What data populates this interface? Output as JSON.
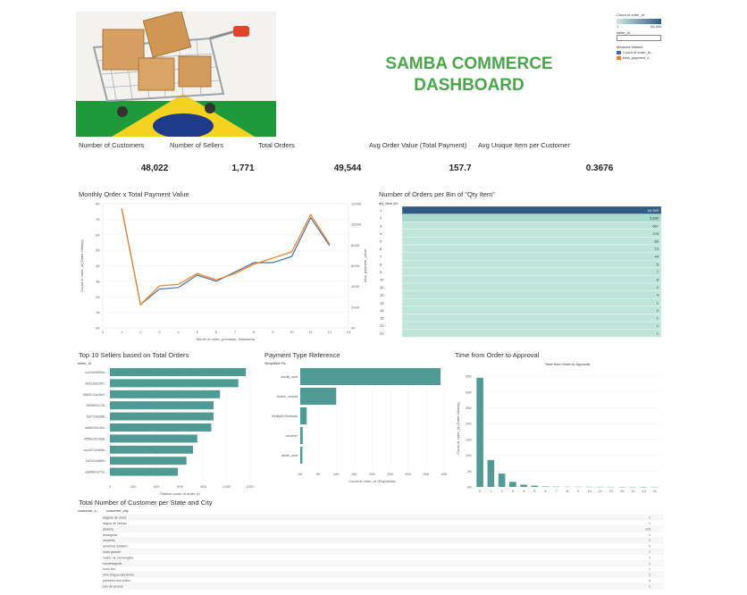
{
  "dashboard": {
    "title_line1": "SAMBA COMMERCE",
    "title_line2": "DASHBOARD"
  },
  "legend": {
    "count_title": "Count of order_id",
    "range_min": "1",
    "range_max": "44,484",
    "seller_filter_label": "seller_id",
    "measure_names_title": "Measure Names",
    "measure1": "Count of order_id...",
    "measure2": "total_payment_v...",
    "color_count": "#4a6fa5",
    "color_payment": "#f07f1b"
  },
  "kpis": [
    {
      "label": "Number of Customers",
      "value": "48,022"
    },
    {
      "label": "Number of Sellers",
      "value": "1,771"
    },
    {
      "label": "Total Orders",
      "value": "49,544"
    },
    {
      "label": "Avg Order Value (Total Payment)",
      "value": "157.7"
    },
    {
      "label": "Avg Unique Item per Customer",
      "value": "0.3676"
    }
  ],
  "sections": {
    "monthly": "Monthly Order x Total Payment Value",
    "bins": "Number of Orders per Bin of \"Qty Item\"",
    "sellers": "Top 10 Sellers based on Total Orders",
    "payment": "Payment Type Reference",
    "approval": "Time from Order to Approval",
    "state_city": "Total Number of Customer per State and City"
  },
  "chart_data": [
    {
      "type": "line",
      "title": "Monthly Order x Total Payment Value",
      "xlabel": "Month of order_purchase_timestamp",
      "ylabel": "Count of order_id (Order History)",
      "ylabel2": "total_payment_value",
      "x": [
        1,
        2,
        3,
        4,
        5,
        6,
        7,
        8,
        9,
        10,
        11,
        12
      ],
      "x_ticks": [
        0,
        1,
        2,
        3,
        4,
        5,
        6,
        7,
        8,
        9,
        10,
        11,
        12,
        13
      ],
      "y_ticks": [
        "0K",
        "1K",
        "2K",
        "3K",
        "4K",
        "5K",
        "6K",
        "7K",
        "8K"
      ],
      "y2_ticks": [
        "0K",
        "200K",
        "400K",
        "600K",
        "800K",
        "1000K",
        "1200K"
      ],
      "ylim": [
        0,
        8000
      ],
      "y2lim": [
        0,
        1200000
      ],
      "series": [
        {
          "color": "#4a6fa5",
          "values": [
            7700,
            1500,
            2500,
            2600,
            3400,
            3000,
            3600,
            4200,
            4200,
            4600,
            7100,
            5300
          ]
        },
        {
          "color": "#f07f1b",
          "values": [
            7700,
            1500,
            2700,
            2800,
            3500,
            3100,
            3500,
            4100,
            4500,
            4900,
            7300,
            5400
          ]
        }
      ]
    },
    {
      "type": "table",
      "title": "Number of Orders per Bin of \"Qty Item\"",
      "header": "qty_item (bi..",
      "rows": [
        {
          "bin": "1",
          "value": "44,393"
        },
        {
          "bin": "2",
          "value": "3,830"
        },
        {
          "bin": "3",
          "value": "667"
        },
        {
          "bin": "4",
          "value": "279"
        },
        {
          "bin": "5",
          "value": "83"
        },
        {
          "bin": "6",
          "value": "73"
        },
        {
          "bin": "7",
          "value": "44"
        },
        {
          "bin": "8",
          "value": "5"
        },
        {
          "bin": "9",
          "value": "7"
        },
        {
          "bin": "10",
          "value": "8"
        },
        {
          "bin": "11",
          "value": "2"
        },
        {
          "bin": "12",
          "value": "4"
        },
        {
          "bin": "13",
          "value": "1"
        },
        {
          "bin": "14",
          "value": "2"
        },
        {
          "bin": "15",
          "value": "1"
        },
        {
          "bin": "20",
          "value": "1"
        },
        {
          "bin": "21",
          "value": "1"
        }
      ]
    },
    {
      "type": "bar",
      "title": "Top 10 Sellers based on Total Orders",
      "header": "seller_id",
      "xlabel": "Distinct count of order_id",
      "categories": [
        "cc419e0650a...",
        "4a3ca9315b7...",
        "6560211a19b4...",
        "1f50f920176f...",
        "7a67c3be8f8...",
        "da8622b14eb...",
        "955fee9216a6...",
        "cca3071e3e9b...",
        "7c67e1448b0...",
        "ea8482cd71d..."
      ],
      "values": [
        1260,
        1190,
        1020,
        960,
        960,
        940,
        810,
        770,
        710,
        630
      ],
      "x_ticks": [
        "0",
        "200",
        "400",
        "600",
        "800",
        "1000",
        "1200"
      ],
      "xlim": [
        0,
        1300
      ],
      "color": "#4f9a94"
    },
    {
      "type": "bar",
      "title": "Payment Type Reference",
      "header": "Simplified Pa..",
      "xlabel": "Count of order_id (Payments)",
      "categories": [
        "credit_card",
        "boleto_cricket",
        "Multiple Methods",
        "voucher",
        "debit_card"
      ],
      "values": [
        39000,
        10000,
        1800,
        700,
        600
      ],
      "x_ticks": [
        "0K",
        "5K",
        "10K",
        "15K",
        "20K",
        "25K",
        "30K",
        "35K",
        "40K"
      ],
      "xlim": [
        0,
        40000
      ],
      "color": "#4f9a94"
    },
    {
      "type": "bar",
      "title": "Time from Order to Approval",
      "ylabel": "Count of order_id (Order History)",
      "categories": [
        "0",
        "1",
        "2",
        "3",
        "4",
        "5",
        "6",
        "7",
        "8",
        "9",
        "10",
        "11",
        "12",
        "13",
        "14",
        "15",
        "31"
      ],
      "values": [
        34500,
        8500,
        4200,
        1600,
        700,
        400,
        150,
        100,
        60,
        40,
        30,
        20,
        15,
        10,
        8,
        5,
        3
      ],
      "y_ticks": [
        "0K",
        "5K",
        "10K",
        "15K",
        "20K",
        "25K",
        "30K",
        "35K"
      ],
      "ylim": [
        0,
        37000
      ],
      "color": "#4f9a94"
    },
    {
      "type": "table",
      "title": "Total Number of Customer per State and City",
      "headers": [
        "customer_s..",
        "customer_city"
      ],
      "rows": [
        {
          "city": "aaguas de arara",
          "value": "1"
        },
        {
          "city": "aagua de campo",
          "value": "1"
        },
        {
          "city": "abaeiro",
          "value": "123"
        },
        {
          "city": "amargosa",
          "value": "1"
        },
        {
          "city": "amarello",
          "value": "1"
        },
        {
          "city": "amarinal daidieiro",
          "value": "2"
        },
        {
          "city": "mata grande",
          "value": "2"
        },
        {
          "city": "matriz de camaragibe",
          "value": "1"
        },
        {
          "city": "monteirapolis",
          "value": "1"
        },
        {
          "city": "novo lino",
          "value": "1"
        },
        {
          "city": "olho d'agua das flores",
          "value": "2"
        },
        {
          "city": "palmeira dos indios",
          "value": "4"
        },
        {
          "city": "pao de acucar",
          "value": "1"
        }
      ]
    }
  ]
}
